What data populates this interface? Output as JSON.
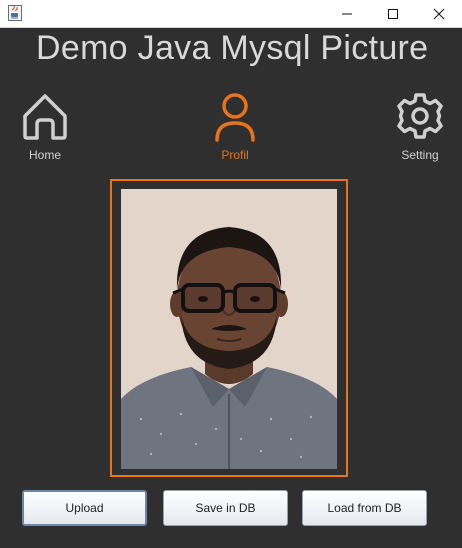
{
  "window": {
    "icon": "java-app-icon",
    "controls": [
      "minimize-icon",
      "maximize-icon",
      "close-icon"
    ]
  },
  "app": {
    "title": "Demo Java Mysql Picture"
  },
  "nav": {
    "home_label": "Home",
    "profil_label": "Profil",
    "setting_label": "Setting",
    "active": "Profil"
  },
  "profile": {
    "photo": "portrait-photo"
  },
  "buttons": {
    "upload": "Upload",
    "save": "Save in DB",
    "load": "Load from DB"
  },
  "colors": {
    "background": "#2f2f2f",
    "accent": "#e8741a",
    "text_inactive": "#d0d0d0"
  }
}
